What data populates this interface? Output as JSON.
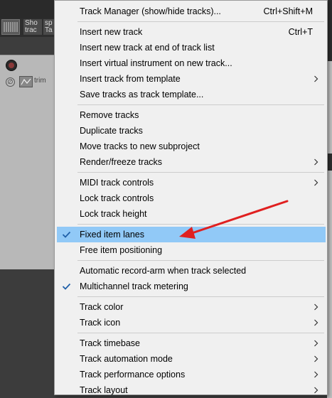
{
  "background": {
    "toolbar_buttons": [
      {
        "line1": "Sho",
        "line2": "trac"
      },
      {
        "line1": "sp",
        "line2": "Ta"
      }
    ],
    "track": {
      "trim_label": "trim"
    }
  },
  "menu": {
    "items": [
      {
        "label": "Track Manager (show/hide tracks)...",
        "shortcut": "Ctrl+Shift+M",
        "submenu": false,
        "checked": false
      },
      {
        "label": "Insert new track",
        "shortcut": "Ctrl+T",
        "submenu": false,
        "checked": false
      },
      {
        "label": "Insert new track at end of track list",
        "shortcut": "",
        "submenu": false,
        "checked": false
      },
      {
        "label": "Insert virtual instrument on new track...",
        "shortcut": "",
        "submenu": false,
        "checked": false
      },
      {
        "label": "Insert track from template",
        "shortcut": "",
        "submenu": true,
        "checked": false
      },
      {
        "label": "Save tracks as track template...",
        "shortcut": "",
        "submenu": false,
        "checked": false
      },
      {
        "label": "Remove tracks",
        "shortcut": "",
        "submenu": false,
        "checked": false
      },
      {
        "label": "Duplicate tracks",
        "shortcut": "",
        "submenu": false,
        "checked": false
      },
      {
        "label": "Move tracks to new subproject",
        "shortcut": "",
        "submenu": false,
        "checked": false
      },
      {
        "label": "Render/freeze tracks",
        "shortcut": "",
        "submenu": true,
        "checked": false
      },
      {
        "label": "MIDI track controls",
        "shortcut": "",
        "submenu": true,
        "checked": false
      },
      {
        "label": "Lock track controls",
        "shortcut": "",
        "submenu": false,
        "checked": false
      },
      {
        "label": "Lock track height",
        "shortcut": "",
        "submenu": false,
        "checked": false
      },
      {
        "label": "Fixed item lanes",
        "shortcut": "",
        "submenu": false,
        "checked": true,
        "highlighted": true
      },
      {
        "label": "Free item positioning",
        "shortcut": "",
        "submenu": false,
        "checked": false
      },
      {
        "label": "Automatic record-arm when track selected",
        "shortcut": "",
        "submenu": false,
        "checked": false
      },
      {
        "label": "Multichannel track metering",
        "shortcut": "",
        "submenu": false,
        "checked": true
      },
      {
        "label": "Track color",
        "shortcut": "",
        "submenu": true,
        "checked": false
      },
      {
        "label": "Track icon",
        "shortcut": "",
        "submenu": true,
        "checked": false
      },
      {
        "label": "Track timebase",
        "shortcut": "",
        "submenu": true,
        "checked": false
      },
      {
        "label": "Track automation mode",
        "shortcut": "",
        "submenu": true,
        "checked": false
      },
      {
        "label": "Track performance options",
        "shortcut": "",
        "submenu": true,
        "checked": false
      },
      {
        "label": "Track layout",
        "shortcut": "",
        "submenu": true,
        "checked": false
      }
    ]
  },
  "colors": {
    "highlight": "#91c9f7",
    "check": "#1f5fa8",
    "annotation_arrow": "#e02020"
  }
}
